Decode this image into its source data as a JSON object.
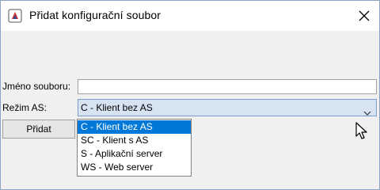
{
  "window": {
    "title": "Přidat konfigurační soubor",
    "close_icon": "close-icon",
    "app_icon": "java-app-icon"
  },
  "form": {
    "filename_label": "Jméno souboru:",
    "filename_value": "",
    "mode_label": "Režim AS:",
    "mode_selected": "C - Klient bez AS",
    "add_button_label": "Přidat"
  },
  "dropdown": {
    "options": [
      "C - Klient bez AS",
      "SC - Klient s AS",
      "S - Aplikační server",
      "WS - Web server"
    ],
    "selected_index": 0
  },
  "colors": {
    "selection": "#0078d7",
    "combo_background": "#d6e3f1",
    "dialog_background": "#f0f0f0"
  }
}
